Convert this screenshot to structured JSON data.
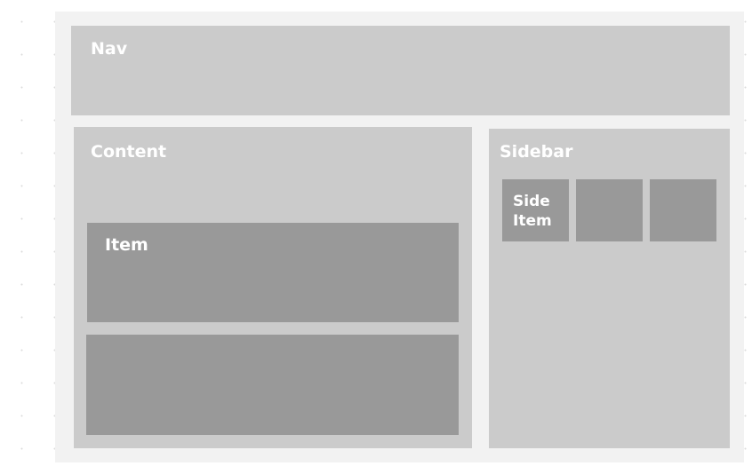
{
  "diagram": {
    "nav": {
      "label": "Nav"
    },
    "content": {
      "label": "Content",
      "items": [
        {
          "label": "Item"
        },
        {
          "label": ""
        }
      ]
    },
    "sidebar": {
      "label": "Sidebar",
      "items": [
        {
          "label": "Side Item"
        },
        {
          "label": ""
        },
        {
          "label": ""
        }
      ]
    }
  },
  "colors": {
    "canvas_dots": "#dcdcdc",
    "frame_background": "#f2f2f2",
    "region_fill": "#cbcbcb",
    "item_fill": "#999999",
    "label_text": "#ffffff"
  }
}
